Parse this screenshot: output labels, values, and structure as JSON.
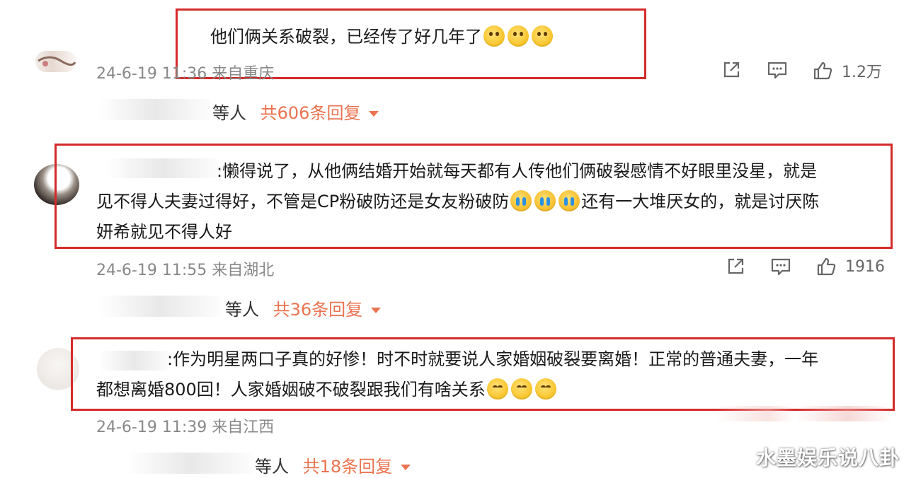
{
  "comments": [
    {
      "text_lines": [
        "他们俩关系破裂，已经传了好几年了"
      ],
      "emoji_after": "pray-hands-icon ×3",
      "time": "24-6-19 11:36 来自重庆",
      "likes": "1.2万",
      "reply_users": "等人",
      "reply_count": "共606条回复"
    },
    {
      "text_lines": [
        ":懒得说了，从他俩结婚开始就每天都有人传他们俩破裂感情不好眼里没星，就是",
        "见不得人夫妻过得好，不管是CP粉破防还是女友粉破防",
        "还有一大堆厌女的，就是讨厌陈",
        "妍希就见不得人好"
      ],
      "time": "24-6-19 11:55 来自湖北",
      "likes": "1916",
      "reply_users": "等人",
      "reply_count": "共36条回复"
    },
    {
      "text_lines": [
        ":作为明星两口子真的好惨！时不时就要说人家婚姻破裂要离婚！正常的普通夫妻，一年",
        "都想离婚800回！人家婚姻破不破裂跟我们有啥关系"
      ],
      "time": "24-6-19 11:39 来自江西",
      "reply_users": "等人",
      "reply_count": "共18条回复"
    }
  ],
  "watermark": "水墨娱乐说八卦",
  "colors": {
    "highlight_border": "#d42a2a",
    "reply_accent": "#eb7350",
    "meta_gray": "#888888"
  }
}
